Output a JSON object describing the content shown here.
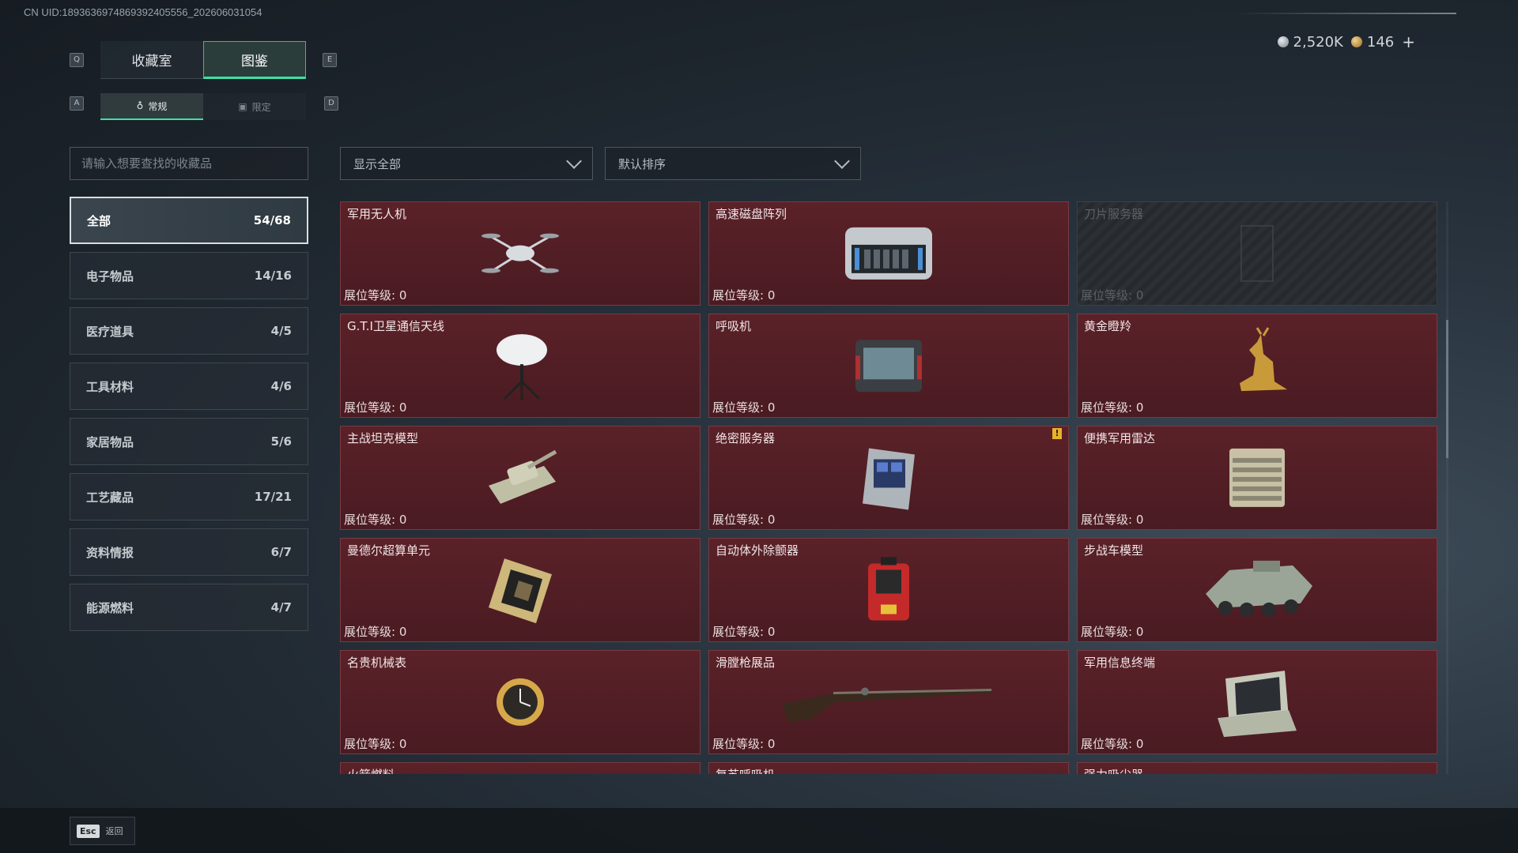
{
  "uid_text": "CN UID:1893636974869392405556_202606031054",
  "tabs": [
    {
      "label": "收藏室",
      "active": false
    },
    {
      "label": "图鉴",
      "active": true
    }
  ],
  "tab_keys": {
    "prev": "Q",
    "next": "E"
  },
  "subtabs": [
    {
      "label": "常规",
      "active": true
    },
    {
      "label": "限定",
      "active": false
    }
  ],
  "subtab_keys": {
    "prev": "A",
    "next": "D"
  },
  "currency": {
    "silver": "2,520K",
    "gold": "146",
    "add": "+"
  },
  "search": {
    "placeholder": "请输入想要查找的收藏品"
  },
  "filter": {
    "label": "显示全部"
  },
  "sort": {
    "label": "默认排序"
  },
  "categories": [
    {
      "label": "全部",
      "count": "54/68",
      "active": true
    },
    {
      "label": "电子物品",
      "count": "14/16"
    },
    {
      "label": "医疗道具",
      "count": "4/5"
    },
    {
      "label": "工具材料",
      "count": "4/6"
    },
    {
      "label": "家居物品",
      "count": "5/6"
    },
    {
      "label": "工艺藏品",
      "count": "17/21"
    },
    {
      "label": "资料情报",
      "count": "6/7"
    },
    {
      "label": "能源燃料",
      "count": "4/7"
    }
  ],
  "level_label": "展位等级: 0",
  "items": [
    {
      "name": "军用无人机",
      "icon": "drone-icon",
      "locked": false
    },
    {
      "name": "高速磁盘阵列",
      "icon": "disk-array-icon",
      "locked": false
    },
    {
      "name": "刀片服务器",
      "icon": "blade-server-icon",
      "locked": true
    },
    {
      "name": "G.T.I卫星通信天线",
      "icon": "satellite-dish-icon",
      "locked": false
    },
    {
      "name": "呼吸机",
      "icon": "ventilator-icon",
      "locked": false
    },
    {
      "name": "黄金瞪羚",
      "icon": "golden-gazelle-icon",
      "locked": false
    },
    {
      "name": "主战坦克模型",
      "icon": "tank-icon",
      "locked": false
    },
    {
      "name": "绝密服务器",
      "icon": "server-icon",
      "locked": false,
      "alert": "!"
    },
    {
      "name": "便携军用雷达",
      "icon": "radar-icon",
      "locked": false
    },
    {
      "name": "曼德尔超算单元",
      "icon": "chip-icon",
      "locked": false
    },
    {
      "name": "自动体外除颤器",
      "icon": "defibrillator-icon",
      "locked": false
    },
    {
      "name": "步战车模型",
      "icon": "ifv-icon",
      "locked": false
    },
    {
      "name": "名贵机械表",
      "icon": "watch-icon",
      "locked": false
    },
    {
      "name": "滑膛枪展品",
      "icon": "musket-icon",
      "locked": false
    },
    {
      "name": "军用信息终端",
      "icon": "terminal-icon",
      "locked": false
    },
    {
      "name": "火箭燃料",
      "icon": "fuel-icon",
      "locked": false
    },
    {
      "name": "复苏呼吸机",
      "icon": "resuscitator-icon",
      "locked": false
    },
    {
      "name": "强力吸尘器",
      "icon": "vacuum-icon",
      "locked": false
    }
  ],
  "back": {
    "key": "Esc",
    "label": "返回"
  }
}
